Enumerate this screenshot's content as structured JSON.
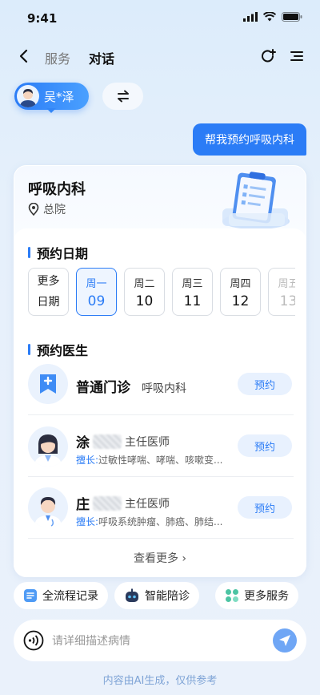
{
  "status_bar": {
    "time": "9:41"
  },
  "nav": {
    "tab_service": "服务",
    "tab_chat": "对话"
  },
  "user": {
    "name": "吴*泽"
  },
  "message": {
    "text": "帮我预约呼吸内科"
  },
  "card": {
    "title": "呼吸内科",
    "location": "总院",
    "date_section": "预约日期",
    "more_dates_line1": "更多",
    "more_dates_line2": "日期",
    "dates": [
      {
        "weekday": "周一",
        "day": "09"
      },
      {
        "weekday": "周二",
        "day": "10"
      },
      {
        "weekday": "周三",
        "day": "11"
      },
      {
        "weekday": "周四",
        "day": "12"
      },
      {
        "weekday": "周五",
        "day": "13"
      }
    ],
    "doctor_section": "预约医生",
    "general": {
      "name": "普通门诊",
      "dept": "呼吸内科",
      "button": "预约"
    },
    "doctors": [
      {
        "surname": "涂",
        "title": "主任医师",
        "specialty_label": "擅长:",
        "specialty": "过敏性哮喘、哮喘、咳嗽变...",
        "button": "预约"
      },
      {
        "surname": "庄",
        "title": "主任医师",
        "specialty_label": "擅长:",
        "specialty": "呼吸系统肿瘤、肺癌、肺结...",
        "button": "预约"
      }
    ],
    "see_more": "查看更多"
  },
  "chips": {
    "records": "全流程记录",
    "assist": "智能陪诊",
    "more": "更多服务"
  },
  "input": {
    "placeholder": "请详细描述病情"
  },
  "footnote": "内容由AI生成，仅供参考",
  "colors": {
    "accent": "#2b7cf6"
  }
}
